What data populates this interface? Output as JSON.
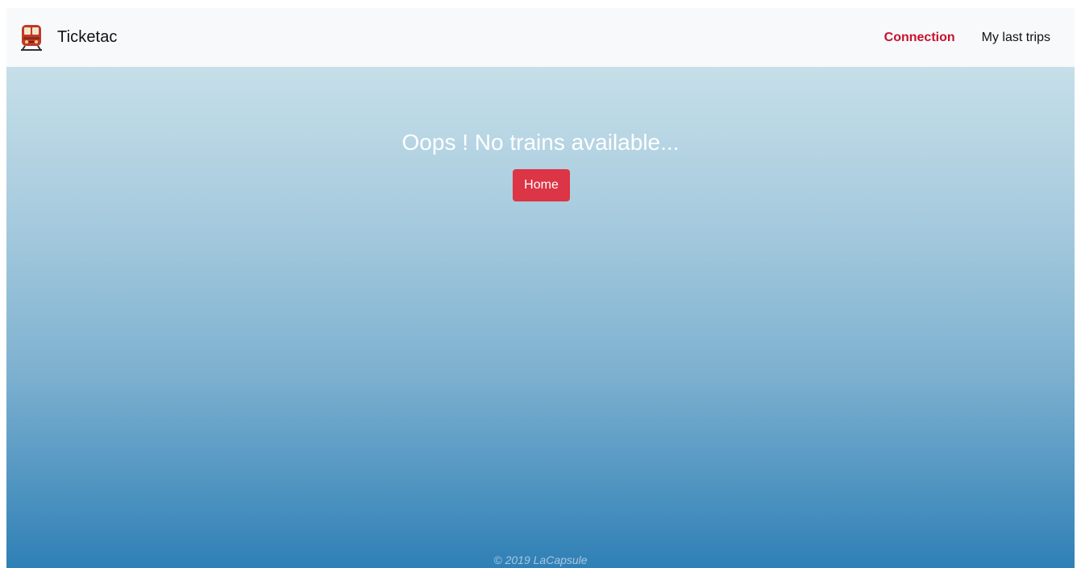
{
  "navbar": {
    "brand": "Ticketac",
    "brand_icon": "train-icon",
    "links": [
      {
        "label": "Connection",
        "active": true
      },
      {
        "label": "My last trips",
        "active": false
      }
    ]
  },
  "main": {
    "message": "Oops ! No trains available...",
    "home_button": "Home"
  },
  "footer": {
    "copyright": "© 2019 LaCapsule"
  },
  "colors": {
    "accent": "#dc3545",
    "active_link": "#c8102e",
    "navbar_bg": "#f8f9fa"
  }
}
